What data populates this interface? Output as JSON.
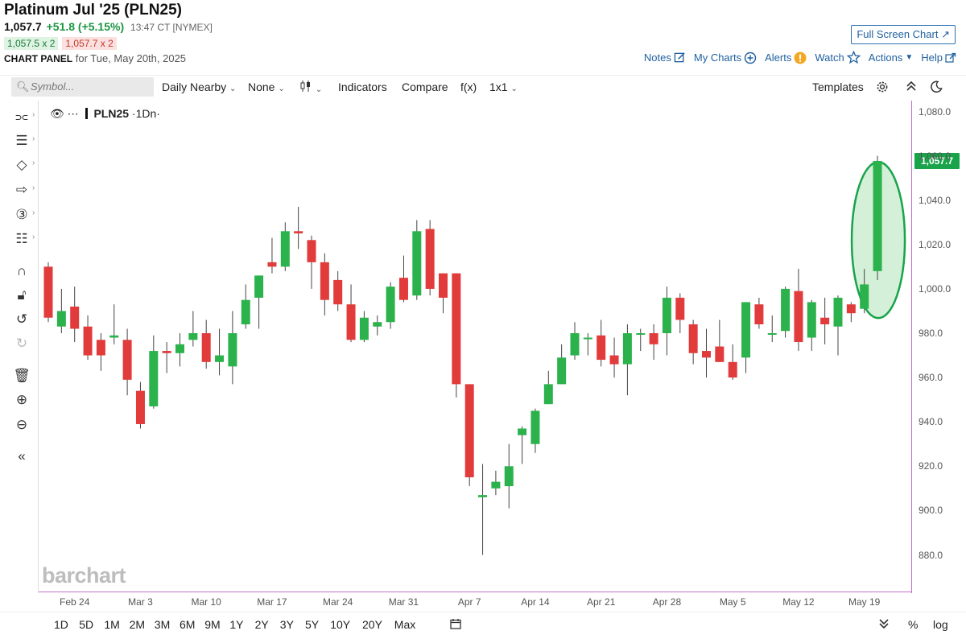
{
  "header": {
    "title": "Platinum Jul '25 (PLN25)",
    "last": "1,057.7",
    "change": "+51.8 (+5.15%)",
    "time": "13:47 CT [NYMEX]",
    "bid": "1,057.5 x 2",
    "ask": "1,057.7 x 2",
    "panel_label": "CHART PANEL",
    "panel_date": "for Tue, May 20th, 2025",
    "fullscreen_label": "Full Screen Chart",
    "links": {
      "notes": "Notes",
      "my_charts": "My Charts",
      "alerts": "Alerts",
      "watch": "Watch",
      "actions": "Actions",
      "help": "Help"
    }
  },
  "toolbar": {
    "search_placeholder": "Symbol...",
    "period": "Daily Nearby",
    "overlay": "None",
    "indicators": "Indicators",
    "compare": "Compare",
    "fx": "f(x)",
    "layout": "1x1",
    "templates": "Templates"
  },
  "legend": {
    "symbol": "PLN25",
    "interval": "·1Dn·"
  },
  "watermark": "barchart",
  "price_tag": "1,057.7",
  "periods": [
    "1D",
    "5D",
    "1M",
    "2M",
    "3M",
    "6M",
    "9M",
    "1Y",
    "2Y",
    "3Y",
    "5Y",
    "10Y",
    "20Y",
    "Max"
  ],
  "bottom_right": {
    "percent": "%",
    "log": "log"
  },
  "colors": {
    "up": "#2bb24c",
    "down": "#e23b3b",
    "accent": "#1f5f9e",
    "highlight": "#19a34a"
  },
  "chart_data": {
    "type": "candlestick",
    "y_ticks": [
      "1,080.0",
      "1,060.0",
      "1,040.0",
      "1,020.0",
      "1,000.0",
      "980.0",
      "960.0",
      "940.0",
      "920.0",
      "900.0",
      "880.0"
    ],
    "x_ticks": [
      "Feb 24",
      "Mar 3",
      "Mar 10",
      "Mar 17",
      "Mar 24",
      "Mar 31",
      "Apr 7",
      "Apr 14",
      "Apr 21",
      "Apr 28",
      "May 5",
      "May 12",
      "May 19"
    ],
    "ylim": [
      866,
      1082
    ],
    "candles": [
      {
        "o": 1010,
        "h": 1012,
        "l": 985,
        "c": 987
      },
      {
        "o": 983,
        "h": 1000,
        "l": 980,
        "c": 990
      },
      {
        "o": 992,
        "h": 1001,
        "l": 976,
        "c": 982
      },
      {
        "o": 983,
        "h": 988,
        "l": 968,
        "c": 970
      },
      {
        "o": 977,
        "h": 980,
        "l": 963,
        "c": 970
      },
      {
        "o": 978,
        "h": 993,
        "l": 975,
        "c": 979
      },
      {
        "o": 977,
        "h": 982,
        "l": 952,
        "c": 959
      },
      {
        "o": 954,
        "h": 958,
        "l": 937,
        "c": 939
      },
      {
        "o": 947,
        "h": 979,
        "l": 946,
        "c": 972
      },
      {
        "o": 972,
        "h": 976,
        "l": 962,
        "c": 971
      },
      {
        "o": 971,
        "h": 980,
        "l": 965,
        "c": 975
      },
      {
        "o": 977,
        "h": 990,
        "l": 974,
        "c": 980
      },
      {
        "o": 980,
        "h": 986,
        "l": 964,
        "c": 967
      },
      {
        "o": 967,
        "h": 982,
        "l": 961,
        "c": 970
      },
      {
        "o": 965,
        "h": 990,
        "l": 957,
        "c": 980
      },
      {
        "o": 984,
        "h": 1002,
        "l": 982,
        "c": 995
      },
      {
        "o": 996,
        "h": 1006,
        "l": 982,
        "c": 1006
      },
      {
        "o": 1012,
        "h": 1023,
        "l": 1007,
        "c": 1010
      },
      {
        "o": 1010,
        "h": 1030,
        "l": 1008,
        "c": 1026
      },
      {
        "o": 1026,
        "h": 1037,
        "l": 1018,
        "c": 1025
      },
      {
        "o": 1022,
        "h": 1024,
        "l": 1000,
        "c": 1012
      },
      {
        "o": 1012,
        "h": 1016,
        "l": 988,
        "c": 995
      },
      {
        "o": 1004,
        "h": 1008,
        "l": 990,
        "c": 993
      },
      {
        "o": 993,
        "h": 1002,
        "l": 976,
        "c": 977
      },
      {
        "o": 977,
        "h": 990,
        "l": 976,
        "c": 987
      },
      {
        "o": 983,
        "h": 988,
        "l": 979,
        "c": 985
      },
      {
        "o": 985,
        "h": 1003,
        "l": 982,
        "c": 1001
      },
      {
        "o": 1005,
        "h": 1015,
        "l": 994,
        "c": 995
      },
      {
        "o": 997,
        "h": 1031,
        "l": 995,
        "c": 1026
      },
      {
        "o": 1027,
        "h": 1031,
        "l": 997,
        "c": 1000
      },
      {
        "o": 1007,
        "h": 1007,
        "l": 989,
        "c": 996
      },
      {
        "o": 1007,
        "h": 1007,
        "l": 951,
        "c": 957
      },
      {
        "o": 957,
        "h": 951,
        "l": 911,
        "c": 915
      },
      {
        "o": 906,
        "h": 921,
        "l": 880,
        "c": 907
      },
      {
        "o": 910,
        "h": 918,
        "l": 907,
        "c": 913
      },
      {
        "o": 911,
        "h": 930,
        "l": 901,
        "c": 920
      },
      {
        "o": 934,
        "h": 938,
        "l": 921,
        "c": 937
      },
      {
        "o": 930,
        "h": 946,
        "l": 926,
        "c": 945
      },
      {
        "o": 948,
        "h": 963,
        "l": 948,
        "c": 957
      },
      {
        "o": 957,
        "h": 975,
        "l": 957,
        "c": 969
      },
      {
        "o": 970,
        "h": 985,
        "l": 968,
        "c": 980
      },
      {
        "o": 978,
        "h": 980,
        "l": 970,
        "c": 978
      },
      {
        "o": 979,
        "h": 986,
        "l": 965,
        "c": 968
      },
      {
        "o": 970,
        "h": 978,
        "l": 960,
        "c": 966
      },
      {
        "o": 966,
        "h": 984,
        "l": 952,
        "c": 980
      },
      {
        "o": 980,
        "h": 982,
        "l": 972,
        "c": 980
      },
      {
        "o": 980,
        "h": 984,
        "l": 968,
        "c": 975
      },
      {
        "o": 980,
        "h": 1001,
        "l": 970,
        "c": 996
      },
      {
        "o": 996,
        "h": 998,
        "l": 980,
        "c": 986
      },
      {
        "o": 984,
        "h": 986,
        "l": 966,
        "c": 971
      },
      {
        "o": 972,
        "h": 982,
        "l": 960,
        "c": 969
      },
      {
        "o": 974,
        "h": 986,
        "l": 968,
        "c": 967
      },
      {
        "o": 967,
        "h": 975,
        "l": 959,
        "c": 960
      },
      {
        "o": 969,
        "h": 994,
        "l": 962,
        "c": 994
      },
      {
        "o": 993,
        "h": 996,
        "l": 982,
        "c": 984
      },
      {
        "o": 980,
        "h": 988,
        "l": 976,
        "c": 980
      },
      {
        "o": 981,
        "h": 1001,
        "l": 978,
        "c": 1000
      },
      {
        "o": 999,
        "h": 1009,
        "l": 972,
        "c": 976
      },
      {
        "o": 978,
        "h": 995,
        "l": 972,
        "c": 994
      },
      {
        "o": 987,
        "h": 996,
        "l": 975,
        "c": 984
      },
      {
        "o": 983,
        "h": 997,
        "l": 970,
        "c": 996
      },
      {
        "o": 993,
        "h": 994,
        "l": 985,
        "c": 989
      },
      {
        "o": 991,
        "h": 1009,
        "l": 989,
        "c": 1002
      },
      {
        "o": 1008,
        "h": 1060,
        "l": 1004,
        "c": 1057.7
      }
    ]
  }
}
